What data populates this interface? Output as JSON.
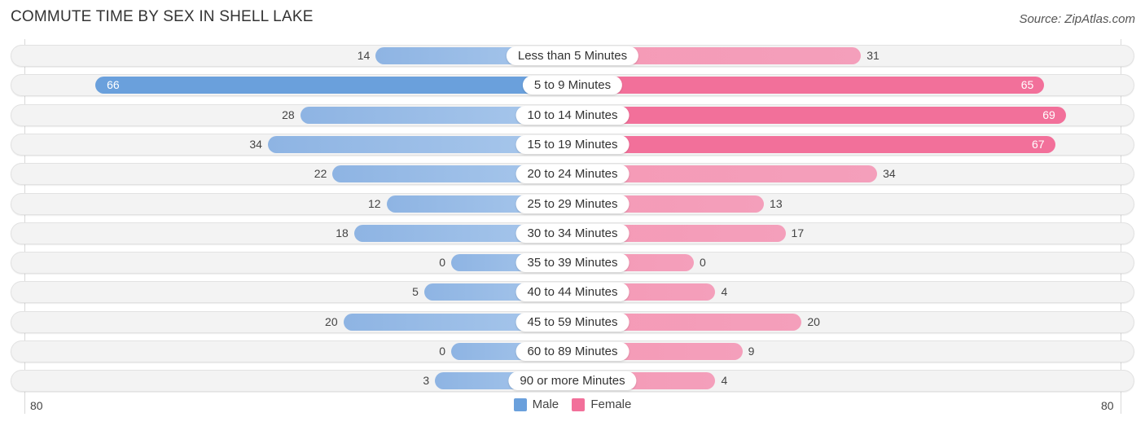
{
  "title": "COMMUTE TIME BY SEX IN SHELL LAKE",
  "source": "Source: ZipAtlas.com",
  "colors": {
    "male": "#6aa0dc",
    "female": "#f2709a"
  },
  "legend": [
    {
      "name": "Male",
      "color": "#6aa0dc"
    },
    {
      "name": "Female",
      "color": "#f2709a"
    }
  ],
  "axis": {
    "left_tick": "80",
    "right_tick": "80"
  },
  "chart_data": {
    "type": "bar",
    "orientation": "horizontal-diverging",
    "title": "COMMUTE TIME BY SEX IN SHELL LAKE",
    "xlabel": "",
    "ylabel": "",
    "xlim": [
      0,
      80
    ],
    "legend_position": "bottom-center",
    "grid": false,
    "categories": [
      "Less than 5 Minutes",
      "5 to 9 Minutes",
      "10 to 14 Minutes",
      "15 to 19 Minutes",
      "20 to 24 Minutes",
      "25 to 29 Minutes",
      "30 to 34 Minutes",
      "35 to 39 Minutes",
      "40 to 44 Minutes",
      "45 to 59 Minutes",
      "60 to 89 Minutes",
      "90 or more Minutes"
    ],
    "series": [
      {
        "name": "Male",
        "values": [
          14,
          66,
          28,
          34,
          22,
          12,
          18,
          0,
          5,
          20,
          0,
          3
        ]
      },
      {
        "name": "Female",
        "values": [
          31,
          65,
          69,
          67,
          34,
          13,
          17,
          0,
          4,
          20,
          9,
          4
        ]
      }
    ]
  }
}
